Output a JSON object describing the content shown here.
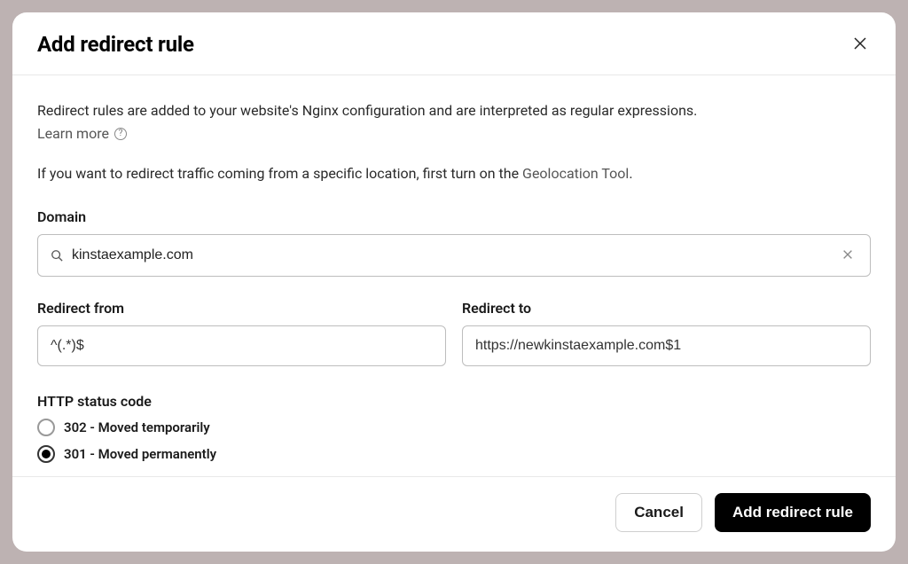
{
  "modal": {
    "title": "Add redirect rule",
    "description": "Redirect rules are added to your website's Nginx configuration and are interpreted as regular expressions.",
    "learn_more": "Learn more",
    "geo_note_prefix": "If you want to redirect traffic coming from a specific location, first turn on the ",
    "geo_link": "Geolocation Tool",
    "geo_note_suffix": "."
  },
  "form": {
    "domain_label": "Domain",
    "domain_value": "kinstaexample.com",
    "redirect_from_label": "Redirect from",
    "redirect_from_value": "^(.*)$",
    "redirect_to_label": "Redirect to",
    "redirect_to_value": "https://newkinstaexample.com$1",
    "status_label": "HTTP status code",
    "status_options": {
      "opt302": "302 - Moved temporarily",
      "opt301": "301 - Moved permanently"
    }
  },
  "footer": {
    "cancel": "Cancel",
    "submit": "Add redirect rule"
  }
}
